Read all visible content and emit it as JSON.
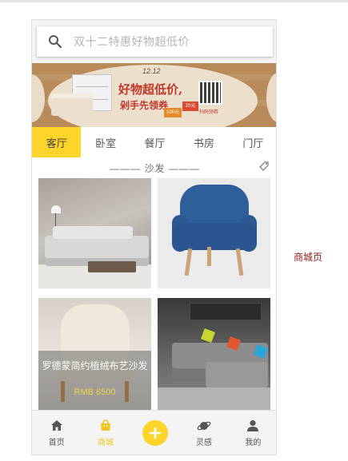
{
  "search": {
    "placeholder": "双十二特惠好物超低价"
  },
  "banner": {
    "date": "12.12",
    "slogan_line1": "好物超低价,",
    "slogan_line2": "剁手先领券",
    "ticket1": "100元",
    "ticket2": "20元",
    "qr_label": "扫码领券"
  },
  "tabs": [
    {
      "label": "客厅",
      "active": true
    },
    {
      "label": "卧室",
      "active": false
    },
    {
      "label": "餐厅",
      "active": false
    },
    {
      "label": "书房",
      "active": false
    },
    {
      "label": "门厅",
      "active": false
    }
  ],
  "section": {
    "title": "——— 沙发 ———"
  },
  "products": {
    "featured_name": "罗德蒙简约植绒布艺沙发",
    "featured_price": "RMB 6500"
  },
  "nav": [
    {
      "label": "首页",
      "icon": "home-icon",
      "active": false
    },
    {
      "label": "商城",
      "icon": "shop-icon",
      "active": true
    },
    {
      "label": "",
      "icon": "plus-icon",
      "active": false
    },
    {
      "label": "灵感",
      "icon": "planet-icon",
      "active": false
    },
    {
      "label": "我的",
      "icon": "user-icon",
      "active": false
    }
  ],
  "side_label": "商城页",
  "colors": {
    "accent": "#fcd42a",
    "active_text": "#f0c419",
    "side_label": "#8b1a1a"
  }
}
